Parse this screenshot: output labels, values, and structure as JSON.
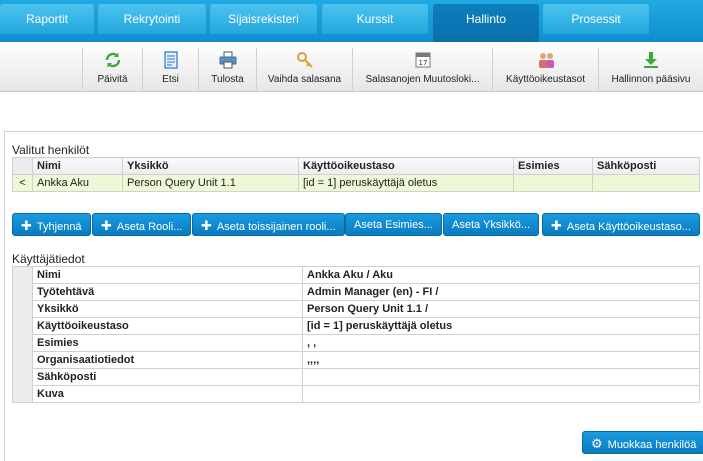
{
  "tabs": [
    {
      "label": "Raportit"
    },
    {
      "label": "Rekrytointi"
    },
    {
      "label": "Sijaisrekisteri"
    },
    {
      "label": "Kurssit"
    },
    {
      "label": "Hallinto"
    },
    {
      "label": "Prosessit"
    }
  ],
  "toolbar": [
    {
      "label": "Päivitä",
      "icon": "refresh-icon"
    },
    {
      "label": "Etsi",
      "icon": "document-search-icon"
    },
    {
      "label": "Tulosta",
      "icon": "printer-icon"
    },
    {
      "label": "Vaihda salasana",
      "icon": "key-icon"
    },
    {
      "label": "Salasanojen Muutosloki...",
      "icon": "calendar-icon"
    },
    {
      "label": "Käyttöoikeustasot",
      "icon": "users-icon"
    },
    {
      "label": "Hallinnon pääsivu",
      "icon": "download-icon"
    }
  ],
  "selected": {
    "title": "Valitut henkilöt",
    "headers": [
      "Nimi",
      "Yksikkö",
      "Käyttöoikeustaso",
      "Esimies",
      "Sähköposti"
    ],
    "rows": [
      {
        "handle": "<",
        "cells": [
          "Ankka Aku",
          "Person Query Unit 1.1",
          "[id = 1] peruskäyttäjä oletus",
          "",
          ""
        ]
      }
    ]
  },
  "actions": [
    {
      "label": "Tyhjennä",
      "plus": "✚"
    },
    {
      "label": "Aseta Rooli...",
      "plus": "✚"
    },
    {
      "label": "Aseta toissijainen rooli...",
      "plus": "✚"
    },
    {
      "label": "Aseta Esimies...",
      "plus": ""
    },
    {
      "label": "Aseta Yksikkö...",
      "plus": ""
    },
    {
      "label": "Aseta Käyttöoikeustaso...",
      "plus": "✚"
    }
  ],
  "userinfo": {
    "title": "Käyttäjätiedot",
    "rows": [
      {
        "label": "Nimi",
        "value": "Ankka Aku / Aku"
      },
      {
        "label": "Työtehtävä",
        "value": "Admin Manager (en) - FI /"
      },
      {
        "label": "Yksikkö",
        "value": "Person Query Unit 1.1 /"
      },
      {
        "label": "Käyttöoikeustaso",
        "value": "[id = 1] peruskäyttäjä oletus"
      },
      {
        "label": "Esimies",
        "value": ", ,"
      },
      {
        "label": "Organisaatiotiedot",
        "value": ",,,,"
      },
      {
        "label": "Sähköposti",
        "value": ""
      },
      {
        "label": "Kuva",
        "value": ""
      }
    ]
  },
  "edit_button": {
    "label": "Muokkaa henkilöä"
  }
}
